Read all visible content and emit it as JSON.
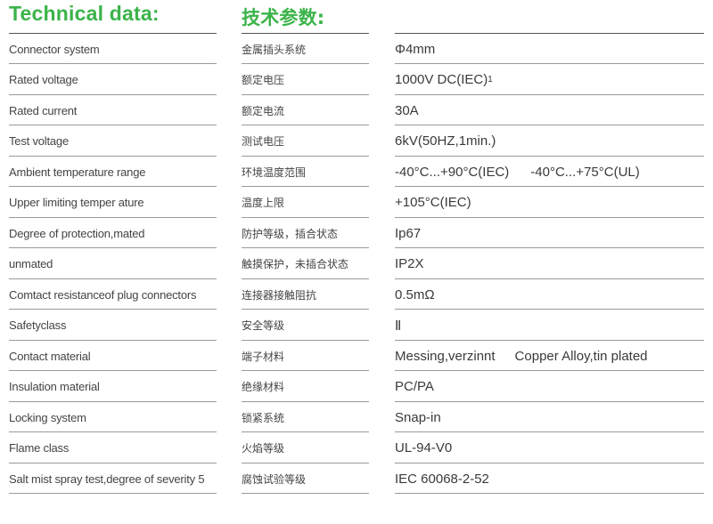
{
  "headings": {
    "en": "Technical data:",
    "cn": "技术参数:"
  },
  "rows": [
    {
      "en": "Connector system",
      "cn": "金属插头系统",
      "value": "Φ4mm"
    },
    {
      "en": "Rated voltage",
      "cn": "额定电压",
      "value": "1000V DC(IEC)",
      "sup": "1"
    },
    {
      "en": "Rated current",
      "cn": "额定电流",
      "value": "30A"
    },
    {
      "en": "Test voltage",
      "cn": "测试电压",
      "value": "6kV(50HZ,1min.)"
    },
    {
      "en": "Ambient temperature range",
      "cn": "环境温度范围",
      "value": "-40°C...+90°C(IEC)",
      "value2": "-40°C...+75°C(UL)"
    },
    {
      "en": "Upper limiting temper ature",
      "cn": "温度上限",
      "value": "+105°C(IEC)"
    },
    {
      "en": "Degree of protection,mated",
      "cn": "防护等级，插合状态",
      "value": "Ip67"
    },
    {
      "en": "unmated",
      "cn": "触摸保护，未插合状态",
      "value": "IP2X"
    },
    {
      "en": "Comtact resistanceof plug connectors",
      "cn": "连接器接触阻抗",
      "value": "0.5mΩ"
    },
    {
      "en": "Safetyclass",
      "cn": "安全等级",
      "value": "Ⅱ"
    },
    {
      "en": "Contact material",
      "cn": "端子材料",
      "value": "Messing,verzinnt",
      "value2": "Copper Alloy,tin plated"
    },
    {
      "en": "Insulation material",
      "cn": "绝缘材料",
      "value": "PC/PA"
    },
    {
      "en": "Locking system",
      "cn": "锁紧系统",
      "value": "Snap-in"
    },
    {
      "en": "Flame class",
      "cn": "火焰等级",
      "value": "UL-94-V0"
    },
    {
      "en": "Salt mist spray test,degree of severity 5",
      "cn": "腐蚀试验等级",
      "value": "IEC 60068-2-52"
    }
  ],
  "colors": {
    "heading": "#3cb34a",
    "text": "#3a3a3a",
    "rule": "#9a9a9a"
  }
}
